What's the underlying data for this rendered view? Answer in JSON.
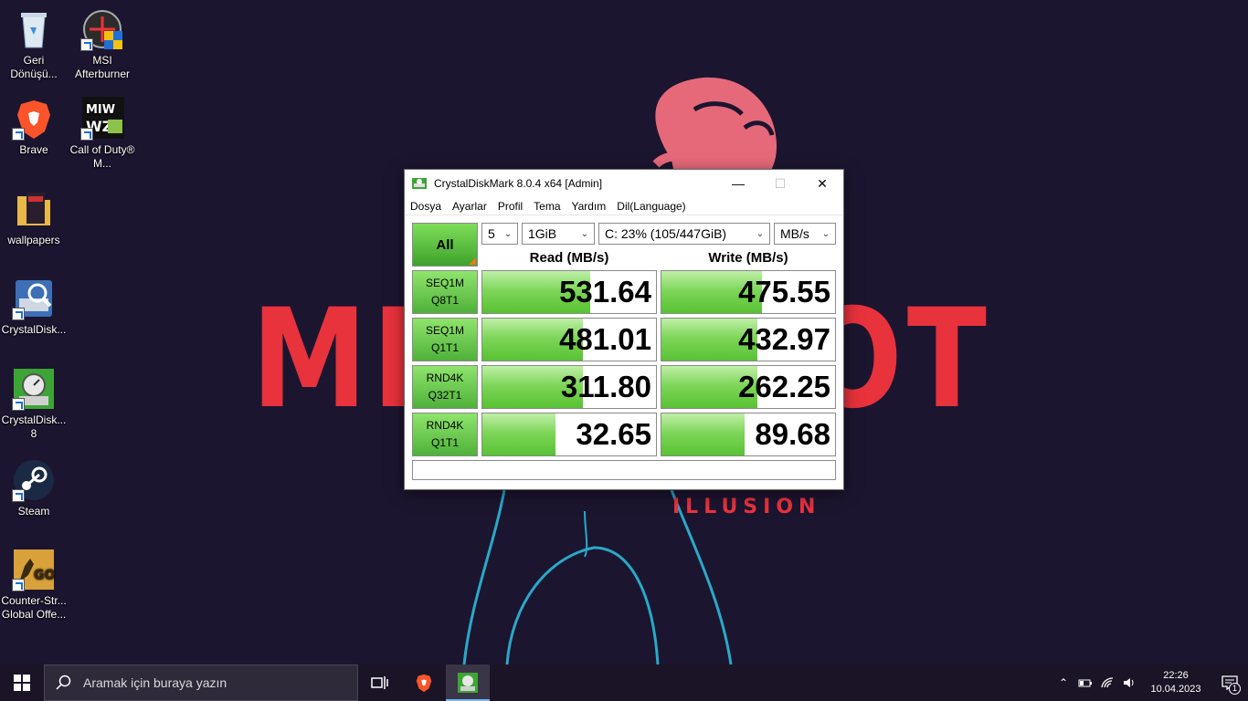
{
  "wallpaper": {
    "title_text": "MR ROBOT",
    "subtitle_text": "ILLUSION"
  },
  "desktop": {
    "icons": [
      {
        "label": "Geri Dönüşü...",
        "icon": "recycle-bin-icon"
      },
      {
        "label": "MSI Afterburner",
        "icon": "msi-afterburner-icon"
      },
      {
        "label": "Brave",
        "icon": "brave-icon"
      },
      {
        "label": "Call of Duty® M...",
        "icon": "call-of-duty-icon"
      },
      {
        "label": "wallpapers",
        "icon": "folder-icon"
      },
      {
        "label": "CrystalDisk...",
        "icon": "crystaldiskinfo-icon"
      },
      {
        "label": "CrystalDisk... 8",
        "icon": "crystaldiskmark-icon"
      },
      {
        "label": "Steam",
        "icon": "steam-icon"
      },
      {
        "label": "Counter-Str... Global Offe...",
        "icon": "csgo-icon"
      }
    ]
  },
  "window": {
    "title": "CrystalDiskMark 8.0.4 x64 [Admin]",
    "menu": [
      "Dosya",
      "Ayarlar",
      "Profil",
      "Tema",
      "Yardım",
      "Dil(Language)"
    ],
    "all_label": "All",
    "count": "5",
    "size": "1GiB",
    "drive": "C: 23% (105/447GiB)",
    "unit": "MB/s",
    "read_header": "Read (MB/s)",
    "write_header": "Write (MB/s)",
    "tests": [
      {
        "line1": "SEQ1M",
        "line2": "Q8T1",
        "read": "531.64",
        "write": "475.55",
        "read_level": 0.62,
        "write_level": 0.58
      },
      {
        "line1": "SEQ1M",
        "line2": "Q1T1",
        "read": "481.01",
        "write": "432.97",
        "read_level": 0.58,
        "write_level": 0.55
      },
      {
        "line1": "RND4K",
        "line2": "Q32T1",
        "read": "311.80",
        "write": "262.25",
        "read_level": 0.58,
        "write_level": 0.55
      },
      {
        "line1": "RND4K",
        "line2": "Q1T1",
        "read": "32.65",
        "write": "89.68",
        "read_level": 0.42,
        "write_level": 0.48
      }
    ],
    "comment": ""
  },
  "taskbar": {
    "search_placeholder": "Aramak için buraya yazın",
    "time": "22:26",
    "date": "10.04.2023",
    "notification_count": "1"
  },
  "colors": {
    "wallpaper_bg": "#1c1530",
    "wallpaper_text": "#e8323c",
    "taskbar_bg": "#1a1426",
    "result_green": "#58c233"
  }
}
